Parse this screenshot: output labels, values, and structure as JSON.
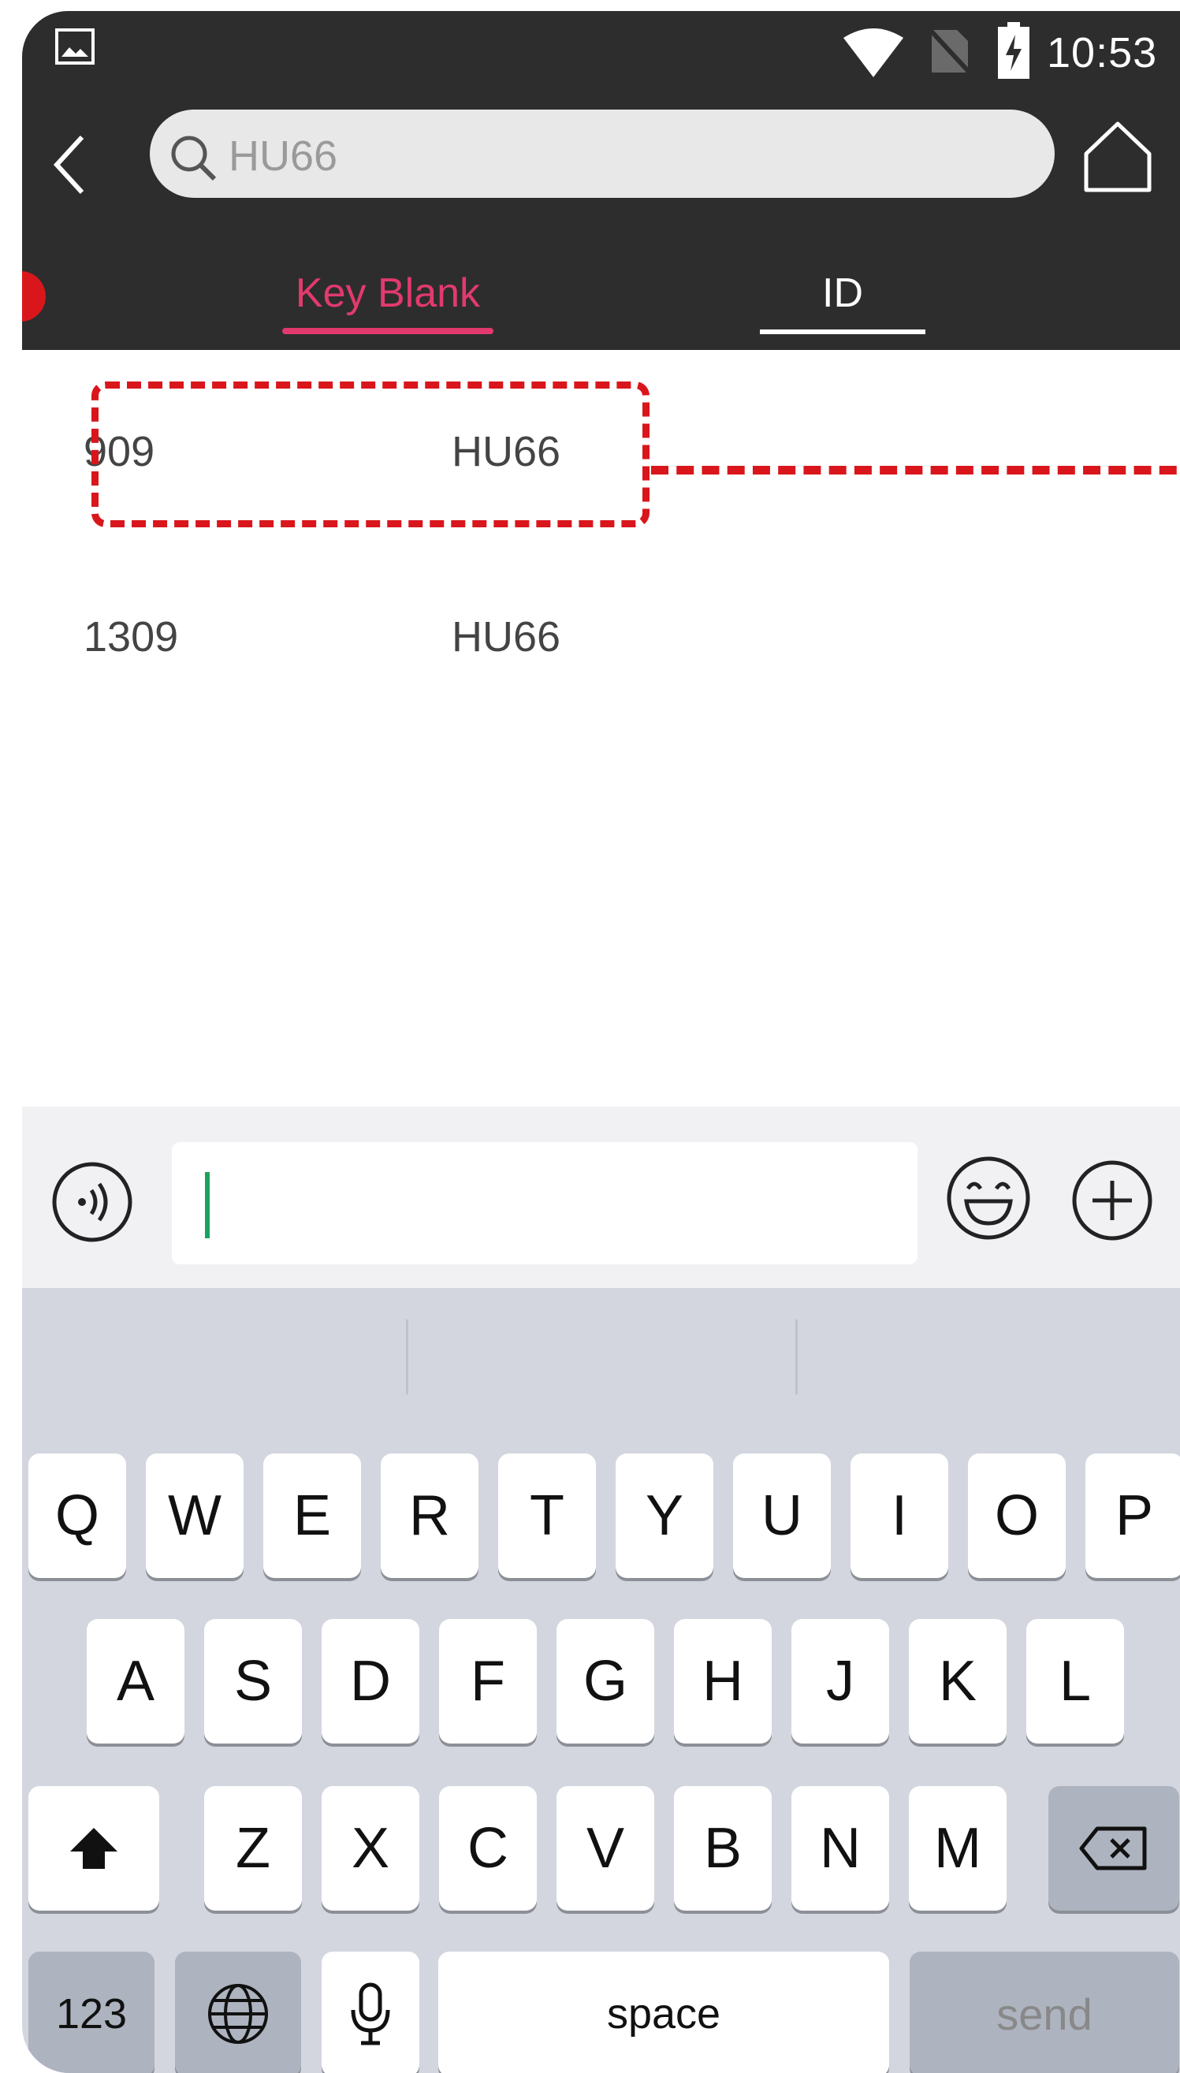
{
  "status_bar": {
    "time": "10:53",
    "icons": [
      "gallery-icon",
      "wifi-icon",
      "no-sim-icon",
      "battery-charging-icon"
    ]
  },
  "header": {
    "search_value": "HU66",
    "tabs": [
      {
        "label": "Key Blank",
        "active": true
      },
      {
        "label": "ID",
        "active": false
      }
    ]
  },
  "results": [
    {
      "col1": "909",
      "col2": "HU66",
      "highlighted": true
    },
    {
      "col1": "1309",
      "col2": "HU66",
      "highlighted": false
    }
  ],
  "input_bar": {
    "value": "",
    "icons": [
      "voice-icon",
      "emoji-icon",
      "plus-icon"
    ]
  },
  "keyboard": {
    "row1": [
      "Q",
      "W",
      "E",
      "R",
      "T",
      "Y",
      "U",
      "I",
      "O",
      "P"
    ],
    "row2": [
      "A",
      "S",
      "D",
      "F",
      "G",
      "H",
      "J",
      "K",
      "L"
    ],
    "row3": [
      "Z",
      "X",
      "C",
      "V",
      "B",
      "N",
      "M"
    ],
    "bottom": {
      "numbers": "123",
      "space": "space",
      "send": "send"
    }
  },
  "colors": {
    "header_bg": "#2d2d2d",
    "accent": "#e23a6e",
    "callout": "#d9161c",
    "keyboard_bg": "#d3d6de"
  }
}
